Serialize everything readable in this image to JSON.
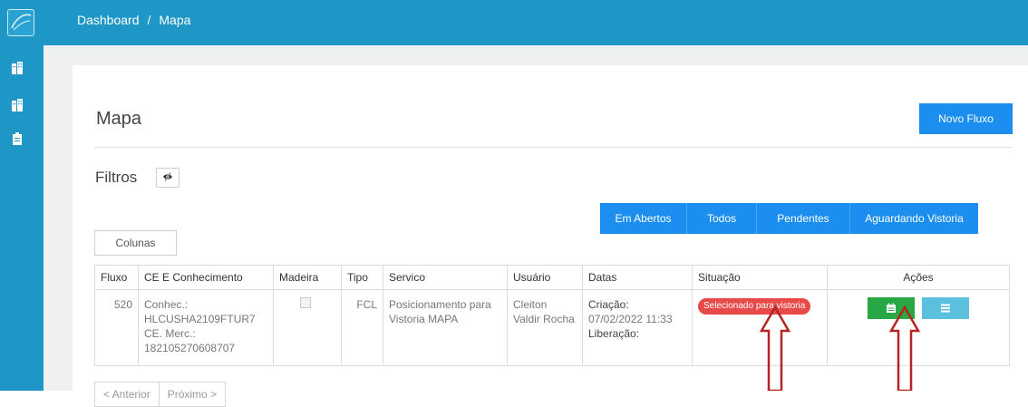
{
  "sidebar": {
    "icons": [
      "logo-icon",
      "building-icon",
      "building-icon",
      "clipboard-icon"
    ]
  },
  "breadcrumb": {
    "root": "Dashboard",
    "separator": "/",
    "current": "Mapa"
  },
  "page": {
    "title": "Mapa",
    "new_button": "Novo Fluxo"
  },
  "filters": {
    "label": "Filtros",
    "buttons": [
      "Em Abertos",
      "Todos",
      "Pendentes",
      "Aguardando Vistoria"
    ]
  },
  "columns_button": "Colunas",
  "table": {
    "headers": [
      "Fluxo",
      "CE E Conhecimento",
      "Madeira",
      "Tipo",
      "Servico",
      "Usuário",
      "Datas",
      "Situação",
      "Ações"
    ],
    "rows": [
      {
        "fluxo": "520",
        "ce_line1": "Conhec.:",
        "ce_line2": "HLCUSHA2109FTUR7",
        "ce_line3": "CE. Merc.:",
        "ce_line4": "182105270608707",
        "madeira_checked": true,
        "tipo": "FCL",
        "servico": "Posicionamento para Vistoria MAPA",
        "usuario": "Cleiton Valdir Rocha",
        "datas_line1": "Criação:",
        "datas_line2": "07/02/2022 11:33",
        "datas_line3": "Liberação:",
        "situacao": "Selecionado para vistoria"
      }
    ]
  },
  "pagination": {
    "prev": "< Anterior",
    "next": "Próximo >"
  },
  "colors": {
    "topbar": "#1e97c6",
    "primary": "#1b8ef0",
    "badge": "#e84a4a",
    "action_green": "#28a745",
    "action_blue": "#5bc0de",
    "arrow": "#b52323"
  }
}
